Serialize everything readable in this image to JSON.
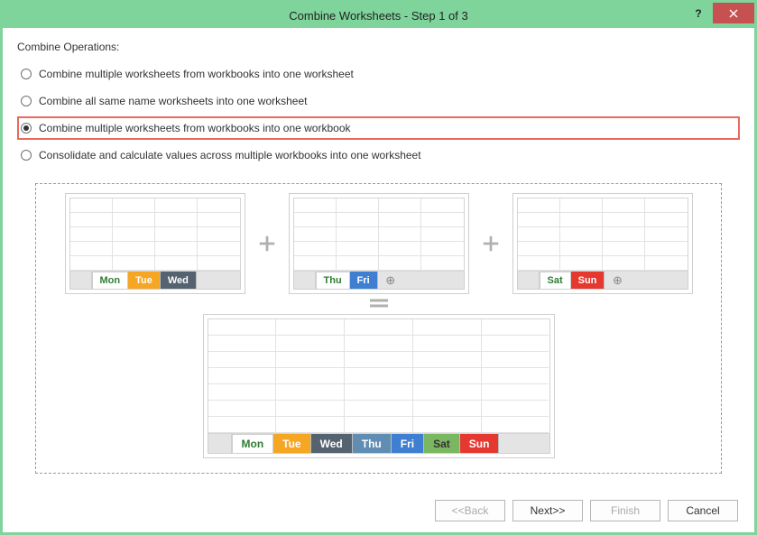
{
  "title": "Combine Worksheets - Step 1 of 3",
  "section_label": "Combine Operations:",
  "options": [
    {
      "label": "Combine multiple worksheets from workbooks into one worksheet",
      "checked": false,
      "highlight": false
    },
    {
      "label": "Combine all same name worksheets into one worksheet",
      "checked": false,
      "highlight": false
    },
    {
      "label": "Combine multiple worksheets from workbooks into one workbook",
      "checked": true,
      "highlight": true
    },
    {
      "label": "Consolidate and calculate values across multiple workbooks into one worksheet",
      "checked": false,
      "highlight": false
    }
  ],
  "diagram": {
    "wb1_tabs": [
      "Mon",
      "Tue",
      "Wed"
    ],
    "wb2_tabs": [
      "Thu",
      "Fri"
    ],
    "wb3_tabs": [
      "Sat",
      "Sun"
    ],
    "result_tabs": [
      "Mon",
      "Tue",
      "Wed",
      "Thu",
      "Fri",
      "Sat",
      "Sun"
    ],
    "add_symbol": "⊕"
  },
  "buttons": {
    "back": "<<Back",
    "next": "Next>>",
    "finish": "Finish",
    "cancel": "Cancel"
  },
  "help_symbol": "?"
}
